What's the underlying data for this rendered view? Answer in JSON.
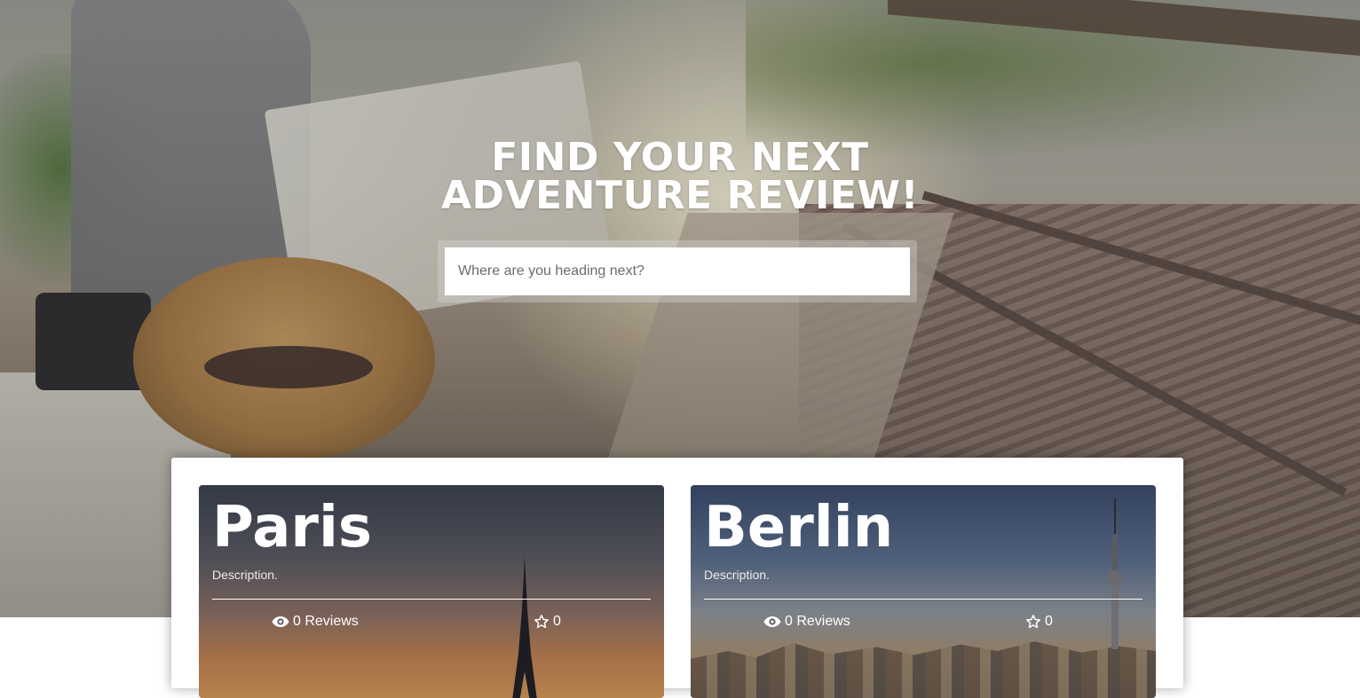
{
  "hero": {
    "title_line1": "FIND YOUR NEXT",
    "title_line2": "ADVENTURE REVIEW!",
    "search": {
      "placeholder": "Where are you heading next?",
      "value": ""
    }
  },
  "destinations": [
    {
      "name": "Paris",
      "description": "Description.",
      "reviews_label": "0 Reviews",
      "rating": "0",
      "icons": {
        "reviews": "eye-icon",
        "rating": "star-icon"
      }
    },
    {
      "name": "Berlin",
      "description": "Description.",
      "reviews_label": "0 Reviews",
      "rating": "0",
      "icons": {
        "reviews": "eye-icon",
        "rating": "star-icon"
      }
    }
  ],
  "colors": {
    "title_text": "#ffffff",
    "panel_background": "#ffffff",
    "divider": "#ffffff"
  }
}
